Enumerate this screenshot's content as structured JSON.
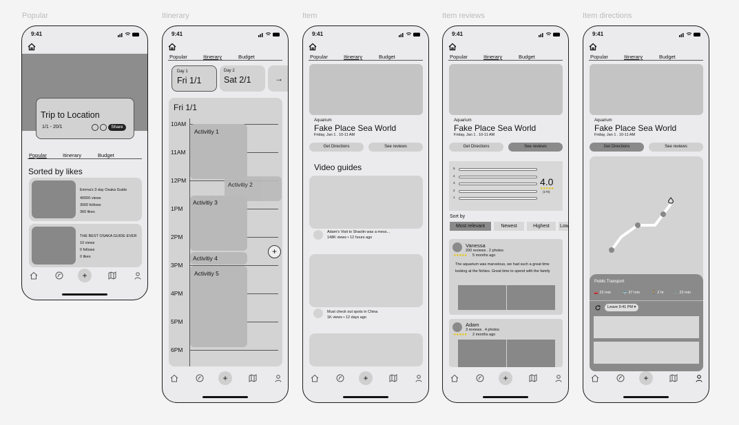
{
  "frames": {
    "popular": "Popular",
    "itinerary": "Itinerary",
    "item": "Item",
    "item_reviews": "Item reviews",
    "item_directions": "Item directions"
  },
  "status": {
    "time": "9:41"
  },
  "tabs": {
    "popular": "Popular",
    "itinerary": "Itinerary",
    "budget": "Budget"
  },
  "popular": {
    "trip_title": "Trip to Location",
    "trip_dates": "1/1 - 20/1",
    "share": "Share",
    "sorted_heading": "Sorted by likes",
    "guides": [
      {
        "title": "Emma's 3 day Osaka Guide",
        "views": "40000 views",
        "follows": "3000 follows",
        "likes": "360 likes"
      },
      {
        "title": "THE BEST OSAKA GUIDE EVER",
        "views": "10 views",
        "follows": "0 follows",
        "likes": "0 likes"
      }
    ]
  },
  "itinerary": {
    "days": [
      {
        "label": "Day 1",
        "date": "Fri 1/1"
      },
      {
        "label": "Day 2",
        "date": "Sat 2/1"
      }
    ],
    "next": "→",
    "day_heading": "Fri 1/1",
    "hours": [
      "10AM",
      "11AM",
      "12PM",
      "1PM",
      "2PM",
      "3PM",
      "4PM",
      "5PM",
      "6PM"
    ],
    "activities": [
      "Activitiy 1",
      "Activitiy 2",
      "Activitiy 3",
      "Activitiy 4",
      "Activitiy 5"
    ],
    "add": "+"
  },
  "item": {
    "category": "Aquarium",
    "name": "Fake Place Sea World",
    "date": "Friday, Jan 1 . 10-11 AM",
    "get_directions": "Get Directions",
    "see_reviews": "See reviews",
    "video_heading": "Video guides",
    "videos": [
      {
        "title": "Adam's Visit to Shaolin was a mess...",
        "meta": "148K views • 12 hours ago"
      },
      {
        "title": "Must check out spots in China",
        "meta": "1K views • 12 days ago"
      }
    ]
  },
  "reviews": {
    "rating": "4.0",
    "rating_count": "(170)",
    "bar_labels": [
      "5",
      "4",
      "3",
      "2",
      "1"
    ],
    "sort_by": "Sort by",
    "sort_options": [
      "Most relevant",
      "Newest",
      "Highest",
      "Low"
    ],
    "list": [
      {
        "name": "Vanessa",
        "counts": "200 reviews . 2 photos",
        "time": "5 months ago",
        "text": "The aquarium was marvelous, we had such a great time looking at the fishies. Great time to spend with the family"
      },
      {
        "name": "Adam",
        "counts": "3 reviews . 4 photos",
        "time": "2 months ago"
      }
    ]
  },
  "directions": {
    "transport_title": "Public Transport",
    "modes": [
      {
        "icon": "car-icon",
        "time": "22 min"
      },
      {
        "icon": "bus-icon",
        "time": "37 min"
      },
      {
        "icon": "walk-icon",
        "time": "2 hr"
      },
      {
        "icon": "bike-icon",
        "time": "22 min"
      }
    ],
    "leave": "Leave 9:41 PM ▾"
  }
}
